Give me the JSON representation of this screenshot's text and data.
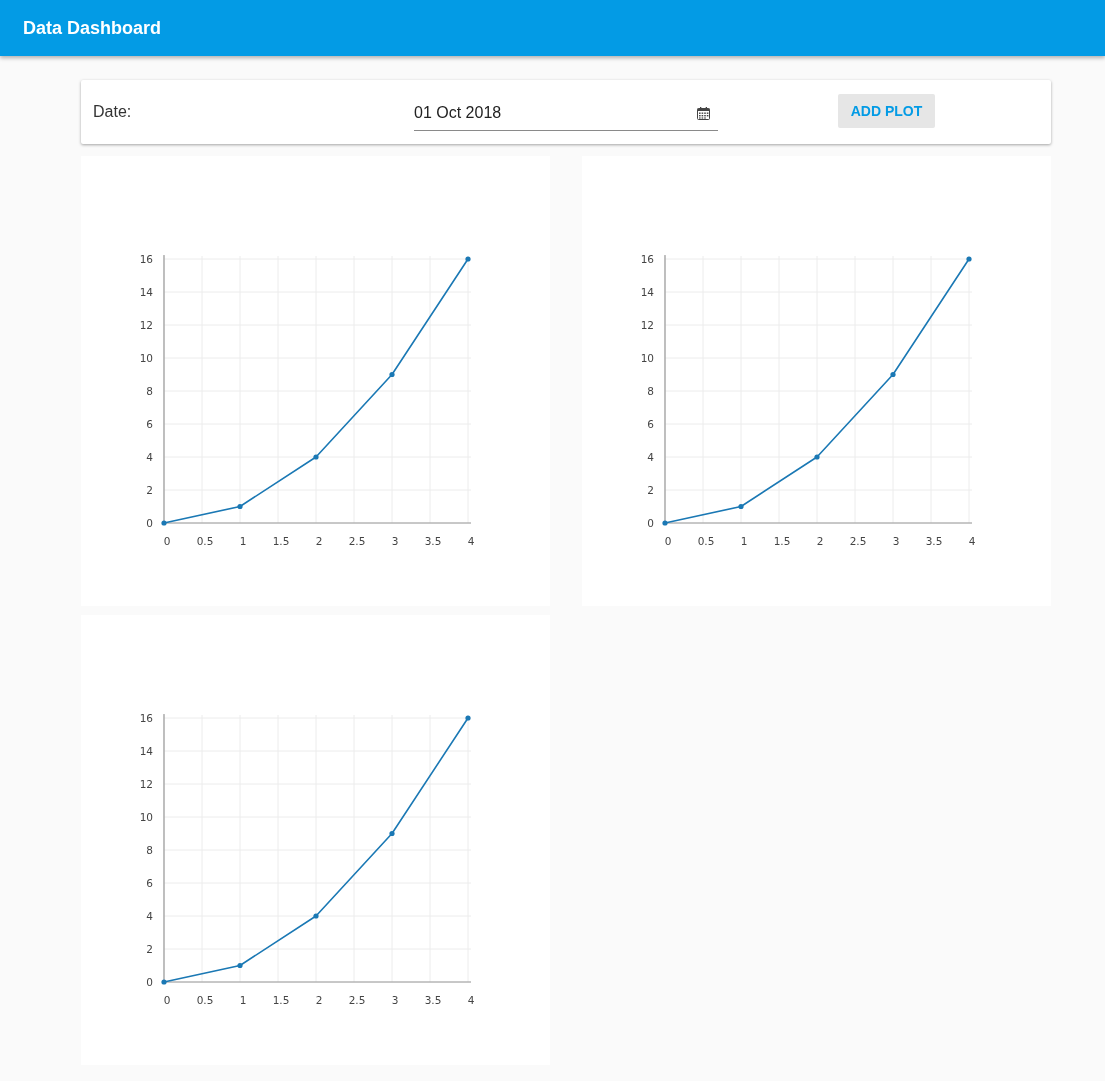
{
  "app_bar": {
    "title": "Data Dashboard"
  },
  "controls": {
    "date_label": "Date:",
    "date_field": {
      "value": "01 Oct 2018"
    },
    "add_button": "ADD PLOT"
  },
  "plots": [
    {
      "chart_data": {
        "type": "line",
        "x": [
          0,
          1,
          2,
          3,
          4
        ],
        "series": [
          {
            "color": "#1a78b4",
            "values": [
              0,
              1,
              4,
              9,
              16
            ]
          }
        ],
        "xlim": [
          0,
          4
        ],
        "ylim": [
          0,
          16
        ],
        "xticks": [
          0,
          0.5,
          1,
          1.5,
          2,
          2.5,
          3,
          3.5,
          4
        ],
        "yticks": [
          0,
          2,
          4,
          6,
          8,
          10,
          12,
          14,
          16
        ],
        "grid": true
      }
    },
    {
      "chart_data": {
        "type": "line",
        "x": [
          0,
          1,
          2,
          3,
          4
        ],
        "series": [
          {
            "color": "#1a78b4",
            "values": [
              0,
              1,
              4,
              9,
              16
            ]
          }
        ],
        "xlim": [
          0,
          4
        ],
        "ylim": [
          0,
          16
        ],
        "xticks": [
          0,
          0.5,
          1,
          1.5,
          2,
          2.5,
          3,
          3.5,
          4
        ],
        "yticks": [
          0,
          2,
          4,
          6,
          8,
          10,
          12,
          14,
          16
        ],
        "grid": true
      }
    },
    {
      "chart_data": {
        "type": "line",
        "x": [
          0,
          1,
          2,
          3,
          4
        ],
        "series": [
          {
            "color": "#1a78b4",
            "values": [
              0,
              1,
              4,
              9,
              16
            ]
          }
        ],
        "xlim": [
          0,
          4
        ],
        "ylim": [
          0,
          16
        ],
        "xticks": [
          0,
          0.5,
          1,
          1.5,
          2,
          2.5,
          3,
          3.5,
          4
        ],
        "yticks": [
          0,
          2,
          4,
          6,
          8,
          10,
          12,
          14,
          16
        ],
        "grid": true
      }
    }
  ]
}
